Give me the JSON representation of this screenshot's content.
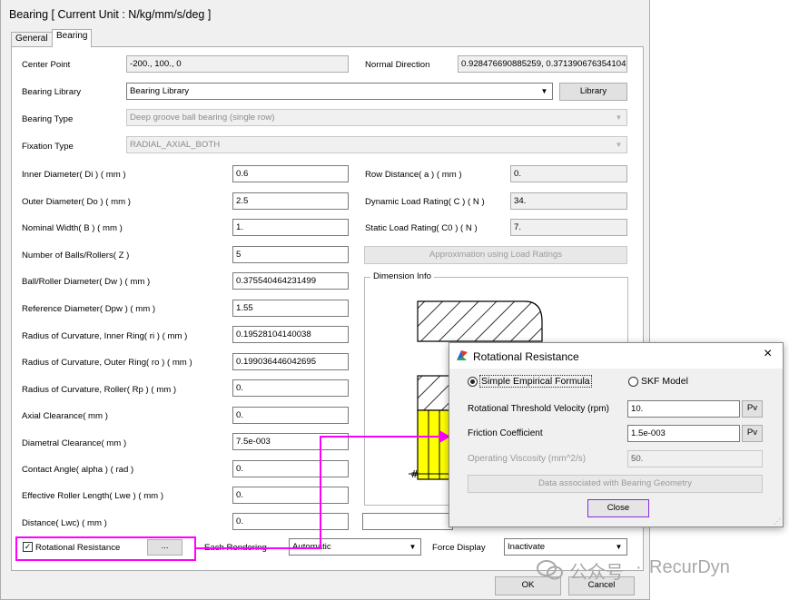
{
  "window": {
    "title": "Bearing [ Current Unit : N/kg/mm/s/deg ]",
    "tabs": [
      "General",
      "Bearing"
    ]
  },
  "left_fields": [
    {
      "label": "Center Point",
      "value": "-200., 100., 0"
    },
    {
      "label": "Inner Diameter( Di ) ( mm )",
      "value": "0.6"
    },
    {
      "label": "Outer Diameter( Do ) ( mm )",
      "value": "2.5"
    },
    {
      "label": "Nominal Width( B ) ( mm )",
      "value": "1."
    },
    {
      "label": "Number of Balls/Rollers( Z )",
      "value": "5"
    },
    {
      "label": "Ball/Roller Diameter( Dw ) ( mm )",
      "value": "0.375540464231499"
    },
    {
      "label": "Reference Diameter( Dpw ) ( mm )",
      "value": "1.55"
    },
    {
      "label": "Radius of Curvature, Inner Ring( ri ) ( mm )",
      "value": "0.19528104140038"
    },
    {
      "label": "Radius of Curvature, Outer Ring( ro ) ( mm )",
      "value": "0.199036446042695"
    },
    {
      "label": "Radius of Curvature, Roller( Rp ) ( mm )",
      "value": "0."
    },
    {
      "label": "Axial Clearance( mm )",
      "value": "0."
    },
    {
      "label": "Diametral Clearance( mm )",
      "value": "7.5e-003"
    },
    {
      "label": "Contact Angle( alpha ) ( rad )",
      "value": "0."
    },
    {
      "label": "Effective Roller Length( Lwe ) ( mm )",
      "value": "0."
    },
    {
      "label": "Distance( Lwc) ( mm )",
      "value": "0."
    }
  ],
  "bearing_library": {
    "label": "Bearing Library",
    "value": "Bearing Library",
    "button": "Library"
  },
  "bearing_type": {
    "label": "Bearing Type",
    "value": "Deep groove ball bearing (single row)"
  },
  "fixation_type": {
    "label": "Fixation Type",
    "value": "RADIAL_AXIAL_BOTH"
  },
  "normal_direction": {
    "label": "Normal Direction",
    "value": "0.928476690885259, 0.371390676354104,"
  },
  "right_fields": [
    {
      "label": "Row Distance( a ) ( mm )",
      "value": "0."
    },
    {
      "label": "Dynamic Load Rating( C ) ( N )",
      "value": "34."
    },
    {
      "label": "Static Load Rating( C0 ) ( N )",
      "value": "7."
    }
  ],
  "approximation_button": "Approximation using Load Ratings",
  "dimension_info_title": "Dimension Info",
  "rotational_resistance": {
    "label": "Rotational Resistance",
    "checked": true,
    "button": "..."
  },
  "rendering": {
    "label": "Each Rendering",
    "value": "Automatic"
  },
  "force_display": {
    "label": "Force Display",
    "value": "Inactivate"
  },
  "ok_label": "OK",
  "cancel_label": "Cancel",
  "popup": {
    "title": "Rotational Resistance",
    "close_glyph": "×",
    "option_simple": "Simple Empirical Formula",
    "option_skf": "SKF Model",
    "selected_option": "Simple Empirical Formula",
    "fields": [
      {
        "label": "Rotational Threshold Velocity (rpm)",
        "value": "10.",
        "pv": "Pv"
      },
      {
        "label": "Friction Coefficient",
        "value": "1.5e-003",
        "pv": "Pv"
      },
      {
        "label": "Operating Viscosity (mm^2/s)",
        "value": "50."
      }
    ],
    "geometry_button": "Data associated with Bearing Geometry",
    "close_button": "Close"
  },
  "watermark": {
    "prefix": "公众号",
    "separator": "·",
    "name": "RecurDyn"
  },
  "colors": {
    "highlight": "#ff00ff",
    "roller_fill": "#ffff00",
    "selected_tab": "#ffffff"
  }
}
